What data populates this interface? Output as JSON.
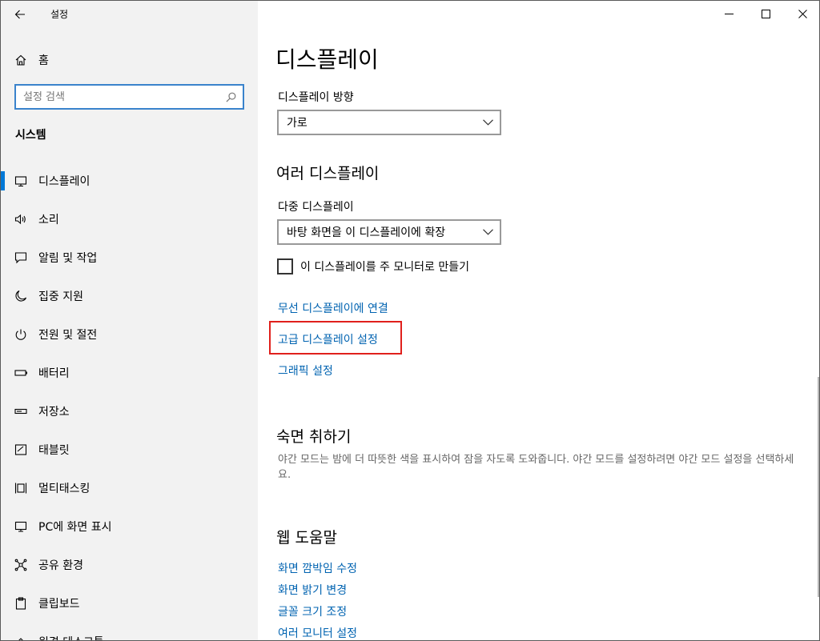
{
  "window": {
    "title": "설정"
  },
  "sidebar": {
    "home_label": "홈",
    "search_placeholder": "설정 검색",
    "section_title": "시스템",
    "items": [
      {
        "label": "디스플레이",
        "icon": "monitor-icon",
        "active": true
      },
      {
        "label": "소리",
        "icon": "speaker-icon"
      },
      {
        "label": "알림 및 작업",
        "icon": "notification-icon"
      },
      {
        "label": "집중 지원",
        "icon": "moon-icon"
      },
      {
        "label": "전원 및 절전",
        "icon": "power-icon"
      },
      {
        "label": "배터리",
        "icon": "battery-icon"
      },
      {
        "label": "저장소",
        "icon": "storage-icon"
      },
      {
        "label": "태블릿",
        "icon": "tablet-icon"
      },
      {
        "label": "멀티태스킹",
        "icon": "multitasking-icon"
      },
      {
        "label": "PC에 화면 표시",
        "icon": "project-icon"
      },
      {
        "label": "공유 환경",
        "icon": "share-icon"
      },
      {
        "label": "클립보드",
        "icon": "clipboard-icon"
      },
      {
        "label": "원격 데스크톱",
        "icon": "remote-icon"
      }
    ]
  },
  "main": {
    "page_title": "디스플레이",
    "orientation": {
      "label": "디스플레이 방향",
      "value": "가로"
    },
    "multi_display": {
      "heading": "여러 디스플레이",
      "label": "다중 디스플레이",
      "value": "바탕 화면을 이 디스플레이에 확장",
      "checkbox_label": "이 디스플레이를 주 모니터로 만들기",
      "checkbox_checked": false
    },
    "links": {
      "wireless": "무선 디스플레이에 연결",
      "advanced": "고급 디스플레이 설정",
      "graphics": "그래픽 설정"
    },
    "sleep": {
      "heading": "숙면 취하기",
      "description": "야간 모드는 밤에 더 따뜻한 색을 표시하여 잠을 자도록 도와줍니다. 야간 모드를 설정하려면 야간 모드 설정을 선택하세요."
    },
    "web_help": {
      "heading": "웹 도움말",
      "links": [
        "화면 깜박임 수정",
        "화면 밝기 변경",
        "글꼴 크기 조정",
        "여러 모니터 설정"
      ]
    }
  },
  "colors": {
    "accent": "#0078d7",
    "link": "#0063b1",
    "highlight": "#e0201c"
  }
}
